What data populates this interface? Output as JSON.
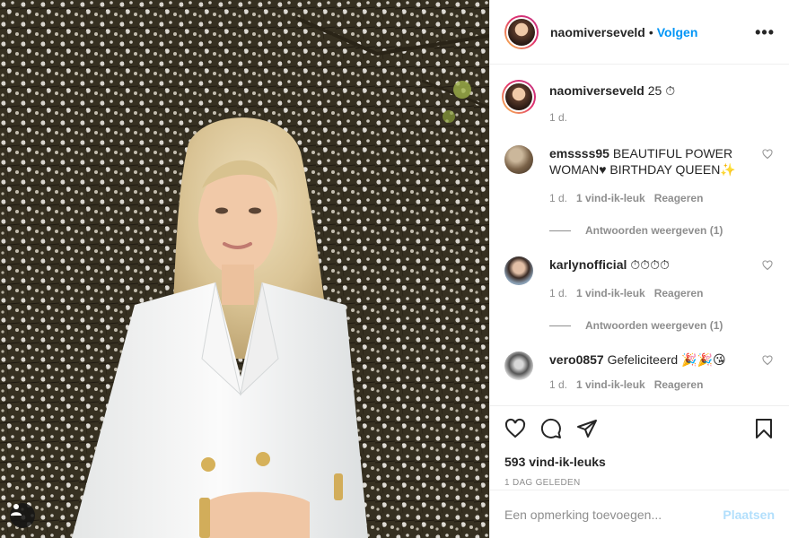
{
  "post": {
    "username": "naomiverseveld",
    "dot": "•",
    "follow_label": "Volgen",
    "more_label": "•••",
    "caption": {
      "username": "naomiverseveld",
      "text": "25 ⏱",
      "time": "1 d."
    },
    "comments": [
      {
        "username": "emssss95",
        "text": "BEAUTIFUL POWER WOMAN♥ BIRTHDAY QUEEN✨",
        "time": "1 d.",
        "likes": "1 vind-ik-leuk",
        "reply": "Reageren",
        "view_replies": "Antwoorden weergeven (1)",
        "avatar_color": "#7a6248"
      },
      {
        "username": "karlynofficial",
        "text": "⏱⏱⏱⏱",
        "time": "1 d.",
        "likes": "1 vind-ik-leuk",
        "reply": "Reageren",
        "view_replies": "Antwoorden weergeven (1)",
        "avatar_color": "#8aa0b5"
      },
      {
        "username": "vero0857",
        "text": "Gefeliciteerd 🎉🎉😘",
        "time": "1 d.",
        "likes": "1 vind-ik-leuk",
        "reply": "Reageren",
        "avatar_color": "#9a9a9a"
      }
    ],
    "likes_count": "593 vind-ik-leuks",
    "date": "1 DAG GELEDEN",
    "comment_placeholder": "Een opmerking toevoegen...",
    "post_button": "Plaatsen",
    "colors": {
      "accent": "#0095f6",
      "muted": "#8e8e8e",
      "post_disabled": "#b2dffc"
    },
    "icons": [
      "heart-icon",
      "comment-icon",
      "share-icon",
      "bookmark-icon",
      "user-tag-icon"
    ]
  }
}
